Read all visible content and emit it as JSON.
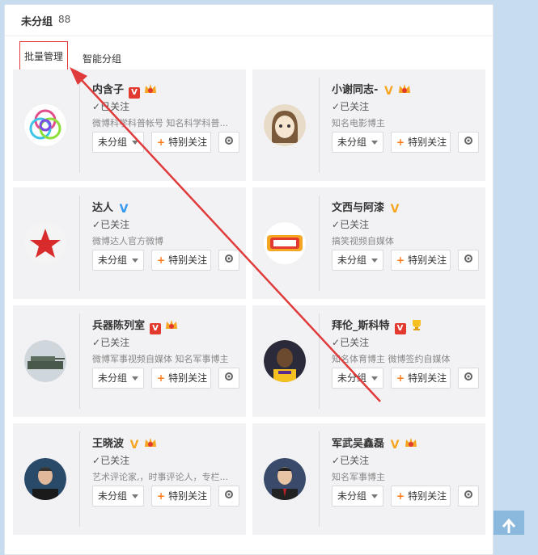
{
  "header": {
    "title": "未分组",
    "count": "88"
  },
  "tabs": {
    "batch": "批量管理",
    "smart": "智能分组"
  },
  "followed_label": "已关注",
  "group_label": "未分组",
  "special_label": "特别关注",
  "users": [
    {
      "name": "内含子",
      "desc": "微博科学科普帐号 知名科学科普...",
      "badge": "red"
    },
    {
      "name": "小谢同志-",
      "desc": "知名电影博主",
      "badge": "yellow"
    },
    {
      "name": "达人",
      "desc": "微博达人官方微博",
      "badge": "blue"
    },
    {
      "name": "文西与阿漆",
      "desc": "搞笑视频自媒体",
      "badge": "yellow"
    },
    {
      "name": "兵器陈列室",
      "desc": "微博军事视频自媒体 知名军事博主",
      "badge": "red"
    },
    {
      "name": "拜伦_斯科特",
      "desc": "知名体育博主 微博签约自媒体",
      "badge": "red"
    },
    {
      "name": "王晓波",
      "desc": "艺术评论家,，时事评论人，专栏...",
      "badge": "yellow"
    },
    {
      "name": "军武吴鑫磊",
      "desc": "知名军事博主",
      "badge": "yellow"
    }
  ],
  "colors": {
    "accent": "#ff7a1a",
    "annotation": "#e03b3b",
    "card_bg": "#f2f2f5"
  },
  "icons": [
    "check-icon",
    "plus-icon",
    "gear-icon",
    "caret-down-icon",
    "scroll-top-icon"
  ]
}
